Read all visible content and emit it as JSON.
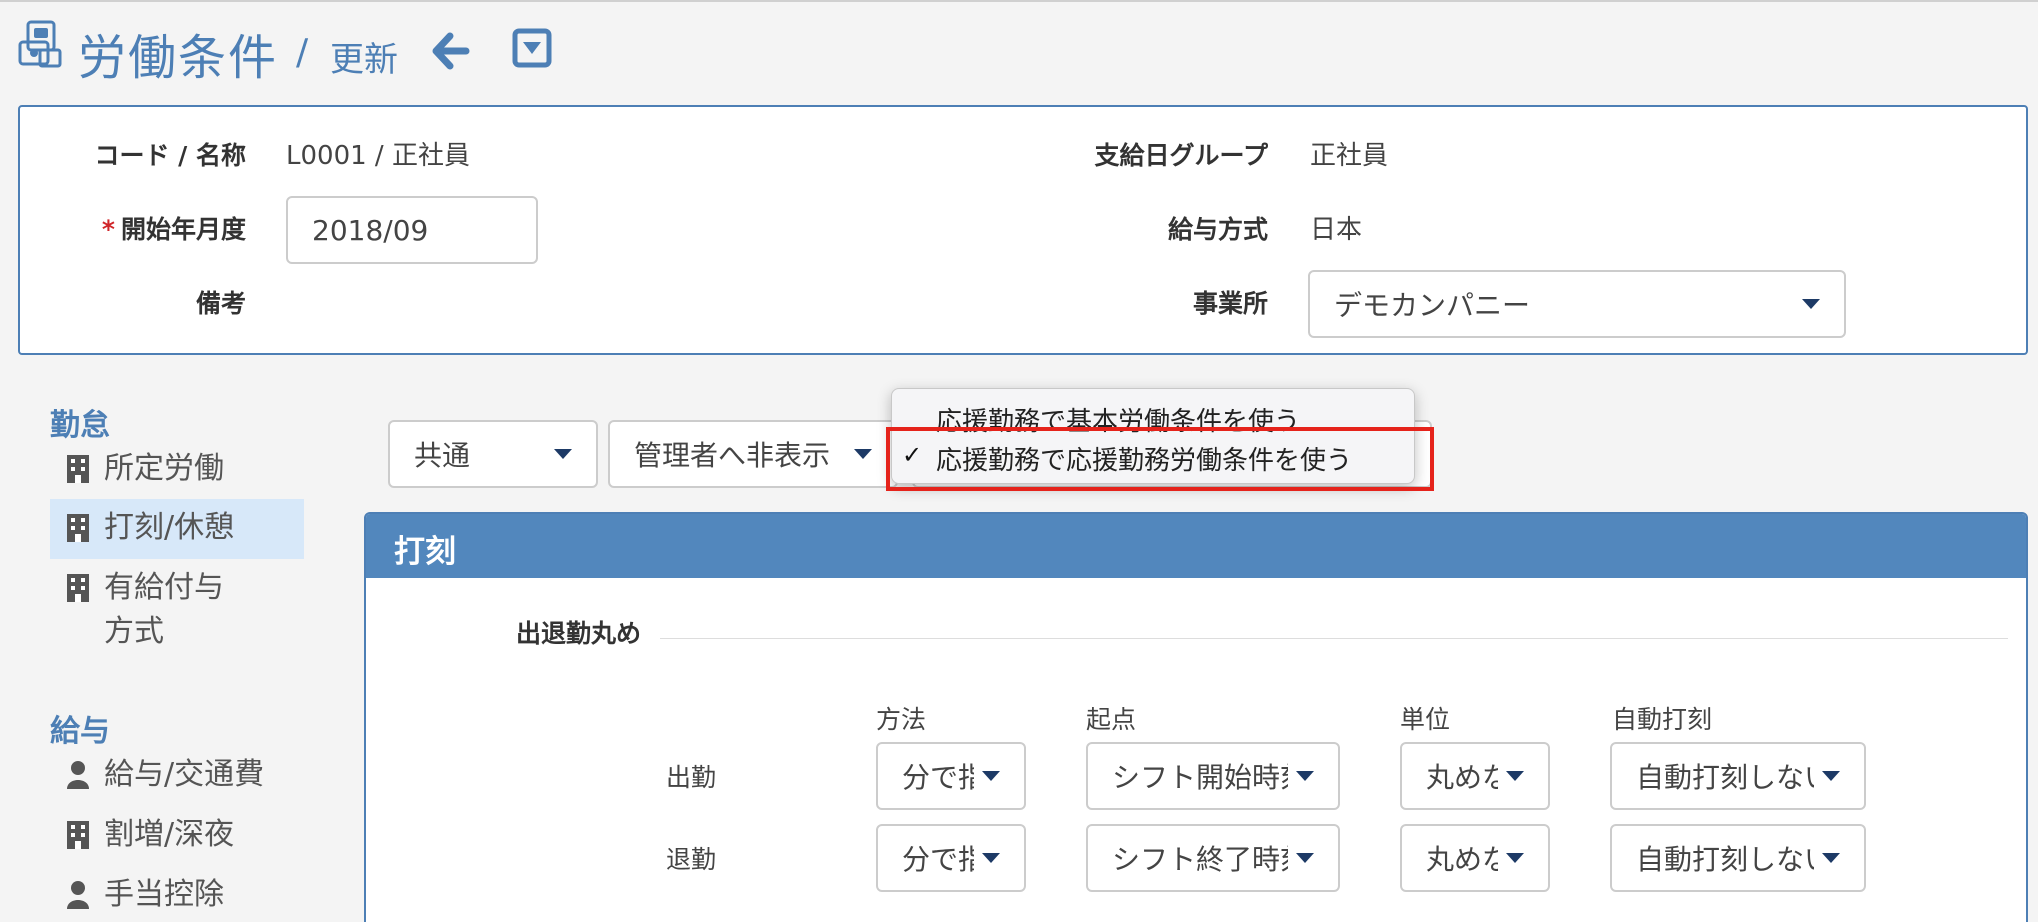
{
  "header": {
    "title": "労働条件",
    "separator": "/",
    "crumb": "更新"
  },
  "info": {
    "code_label": "コード / 名称",
    "code_value": "L0001 / 正社員",
    "start_required_mark": "*",
    "start_label": "開始年月度",
    "start_value": "2018/09",
    "note_label": "備考",
    "payday_group_label": "支給日グループ",
    "payday_group_value": "正社員",
    "salary_method_label": "給与方式",
    "salary_method_value": "日本",
    "office_label": "事業所",
    "office_value": "デモカンパニー"
  },
  "sidebar": {
    "attendance_heading": "勤怠",
    "attendance_items": [
      {
        "label": "所定労働",
        "icon": "building-icon"
      },
      {
        "label": "打刻/休憩",
        "icon": "building-icon",
        "active": true
      },
      {
        "label": "有給付与方式",
        "icon": "building-icon"
      }
    ],
    "salary_heading": "給与",
    "salary_items": [
      {
        "label": "給与/交通費",
        "icon": "person-icon"
      },
      {
        "label": "割増/深夜",
        "icon": "building-icon"
      },
      {
        "label": "手当控除",
        "icon": "person-icon"
      }
    ]
  },
  "filters": {
    "scope_value": "共通",
    "visibility_value": "管理者へ非表示"
  },
  "dropdown": {
    "options": [
      {
        "label": "応援勤務で基本労働条件を使う",
        "selected": false
      },
      {
        "label": "応援勤務で応援勤務労働条件を使う",
        "selected": true
      }
    ],
    "check_mark": "✓"
  },
  "panel": {
    "title": "打刻",
    "section_title": "出退勤丸め",
    "columns": [
      "方法",
      "起点",
      "単位",
      "自動打刻"
    ],
    "rows": [
      {
        "label": "出勤",
        "method": "分で指定",
        "origin": "シフト開始時刻",
        "unit": "丸めない",
        "auto": "自動打刻しない"
      },
      {
        "label": "退勤",
        "method": "分で指定",
        "origin": "シフト終了時刻",
        "unit": "丸めない",
        "auto": "自動打刻しない"
      }
    ]
  },
  "colors": {
    "accent": "#4d7fb5",
    "panel_header": "#5287bd",
    "sidebar_active": "#d7e8f9",
    "highlight_box": "#e5231b",
    "required": "#d0262a"
  }
}
